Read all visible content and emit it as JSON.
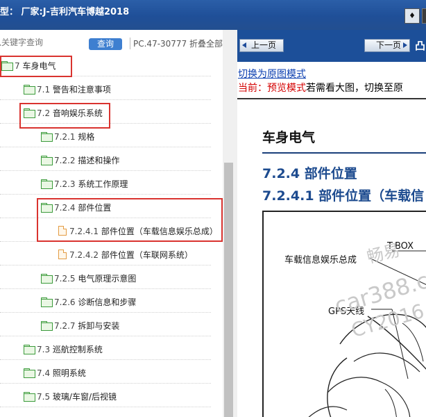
{
  "window": {
    "title": "型： 厂家:J-吉利汽车博越2018",
    "button_icon": "restore-icon"
  },
  "left": {
    "search": {
      "placeholder": "入关键字查询"
    },
    "query_button": "查询",
    "pc_text": "PC.47-30777 折叠全部",
    "tree": [
      {
        "num": "7",
        "label": "车身电气",
        "icon": "folder-open-icon"
      },
      {
        "num": "7.1",
        "label": "警告和注意事项",
        "icon": "folder-icon"
      },
      {
        "num": "7.2",
        "label": "音响娱乐系统",
        "icon": "folder-open-icon"
      },
      {
        "num": "7.2.1",
        "label": "规格",
        "icon": "folder-icon"
      },
      {
        "num": "7.2.2",
        "label": "描述和操作",
        "icon": "folder-icon"
      },
      {
        "num": "7.2.3",
        "label": "系统工作原理",
        "icon": "folder-icon"
      },
      {
        "num": "7.2.4",
        "label": "部件位置",
        "icon": "folder-open-icon"
      },
      {
        "num": "7.2.4.1",
        "label": "部件位置（车载信息娱乐总成）",
        "icon": "document-icon"
      },
      {
        "num": "7.2.4.2",
        "label": "部件位置（车联网系统）",
        "icon": "document-icon"
      },
      {
        "num": "7.2.5",
        "label": "电气原理示意图",
        "icon": "folder-icon"
      },
      {
        "num": "7.2.6",
        "label": "诊断信息和步骤",
        "icon": "folder-icon"
      },
      {
        "num": "7.2.7",
        "label": "拆卸与安装",
        "icon": "folder-icon"
      },
      {
        "num": "7.3",
        "label": "巡航控制系统",
        "icon": "folder-icon"
      },
      {
        "num": "7.4",
        "label": "照明系统",
        "icon": "folder-icon"
      },
      {
        "num": "7.5",
        "label": "玻璃/车窗/后视镜",
        "icon": "folder-icon"
      }
    ]
  },
  "right": {
    "prev_button": "上一页",
    "next_button": "下一页",
    "extra_char": "凸",
    "switch_link": "切换为原图模式",
    "preview_current": "当前：",
    "preview_mode": "预览模式",
    "preview_hint": "若需看大图，切换至原",
    "document": {
      "section": "车身电气",
      "heading": "7.2.4 部件位置",
      "subheading": "7.2.4.1 部件位置（车载信",
      "figure_labels": [
        "T-BOX",
        "车载信息娱乐总成",
        "GPS天线"
      ],
      "watermarks": [
        "畅易",
        "car388.co",
        "CY2016"
      ]
    }
  },
  "colors": {
    "title_bar": "#1f4f98",
    "nav_bar": "#1c4f99",
    "highlight_box": "#d9332f",
    "query_button": "#3e7fd0",
    "link": "#0b3fb0",
    "preview_red": "#d40000",
    "heading_blue": "#1d4b8f"
  }
}
